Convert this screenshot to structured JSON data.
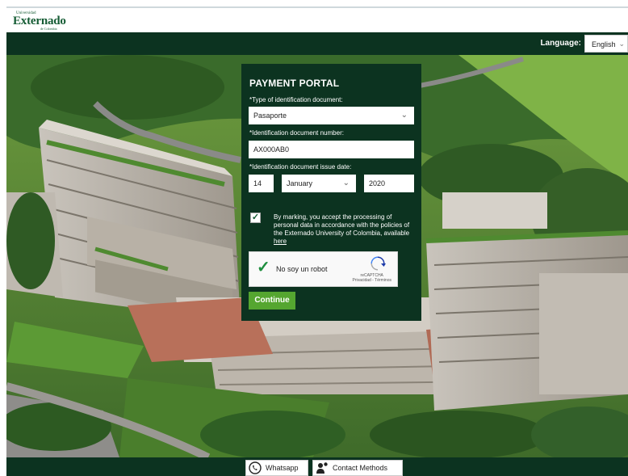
{
  "header": {
    "logo_top": "Universidad",
    "logo_main": "Externado",
    "logo_bottom": "de Colombia",
    "language_label": "Language:",
    "language_value": "English"
  },
  "form": {
    "title": "PAYMENT PORTAL",
    "doc_type_label": "*Type of identification document:",
    "doc_type_value": "Pasaporte",
    "doc_number_label": "*Identification document number:",
    "doc_number_value": "AX000AB0",
    "issue_date_label": "*Identification document issue date:",
    "issue_day": "14",
    "issue_month": "January",
    "issue_year": "2020",
    "consent_checked": true,
    "consent_text": "By marking, you accept the processing of personal data in accordance with the policies of the Externado University of Colombia, available ",
    "consent_link": "here",
    "captcha_label": "No soy un robot",
    "captcha_brand": "reCAPTCHA",
    "captcha_terms": "Privacidad - Términos",
    "continue_label": "Continue"
  },
  "footer": {
    "whatsapp_label": "Whatsapp",
    "contact_label": "Contact Methods"
  },
  "colors": {
    "brand_dark_green": "#0c3320",
    "button_green": "#55a630",
    "logo_green": "#155c34"
  },
  "icons": {
    "dropdown": "chevron-down-icon",
    "captcha_check": "checkmark-icon",
    "whatsapp": "whatsapp-icon",
    "contact": "contact-person-icon"
  }
}
